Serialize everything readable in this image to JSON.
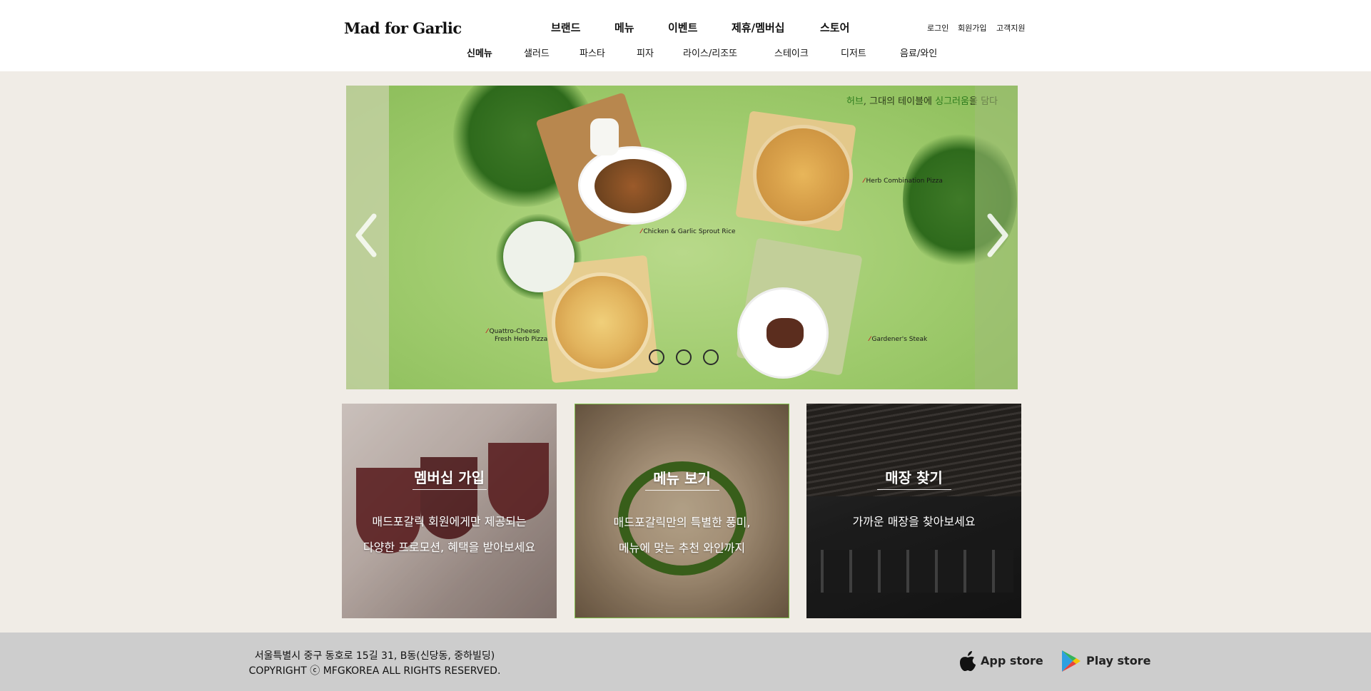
{
  "header": {
    "logo": "Mad for Garlic",
    "main_nav": [
      "브랜드",
      "메뉴",
      "이벤트",
      "제휴/멤버십",
      "스토어"
    ],
    "util_nav": [
      "로그인",
      "회원가입",
      "고객지원"
    ],
    "sub_nav": [
      "신메뉴",
      "샐러드",
      "파스타",
      "피자",
      "라이스/리조또",
      "스테이크",
      "디저트",
      "음료/와인"
    ],
    "sub_nav_active": "신메뉴"
  },
  "hero": {
    "tagline_part1": "허브",
    "tagline_part2": ", 그대의 테이블에 ",
    "tagline_part3": "싱그러움",
    "tagline_part4": "을 담다",
    "captions": {
      "pizza1": "Herb Combination Pizza",
      "rice": "Chicken & Garlic Sprout Rice",
      "pizza2_line1": "Quattro-Cheese",
      "pizza2_line2": "Fresh Herb Pizza",
      "steak": "Gardener's Steak"
    },
    "slide_count": 3,
    "colors": {
      "background": "#9fcb6d",
      "accent": "#2f7d1e",
      "caption_mark": "#c21f1f"
    },
    "icons": {
      "prev": "chevron-left-icon",
      "next": "chevron-right-icon"
    }
  },
  "cards": [
    {
      "title": "멤버십 가입",
      "line1": "매드포갈릭 회원에게만 제공되는",
      "line2": "다양한 프로모션, 혜택을 받아보세요"
    },
    {
      "title": "메뉴 보기",
      "line1": "매드포갈릭만의 특별한 풍미,",
      "line2": "메뉴에 맞는 추천 와인까지"
    },
    {
      "title": "매장 찾기",
      "line1": "가까운 매장을 찾아보세요",
      "line2": ""
    }
  ],
  "footer": {
    "address": "서울특별시 중구 동호로 15길 31, B동(신당동, 중하빌딩)",
    "copyright": "COPYRIGHT ⓒ MFGKOREA ALL RIGHTS RESERVED.",
    "app_store": "App store",
    "play_store": "Play store"
  }
}
